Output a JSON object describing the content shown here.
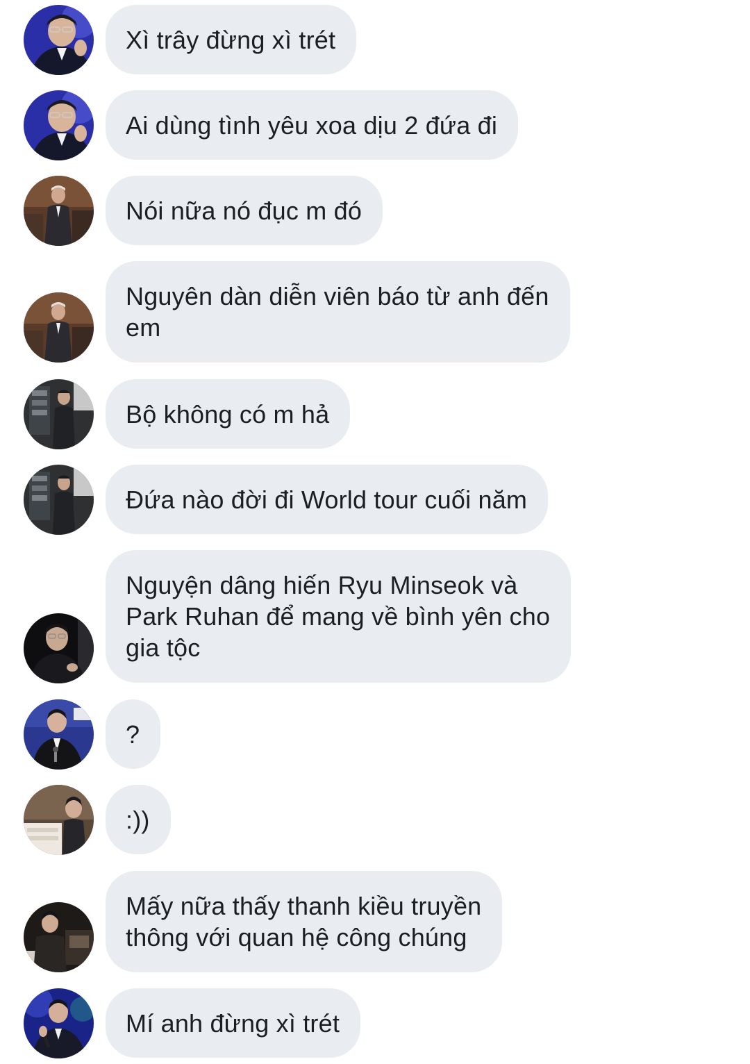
{
  "messages": [
    {
      "text": "Xì trây đừng xì trét",
      "avatar": "avatar-blue-stage"
    },
    {
      "text": "Ai dùng tình yêu xoa dịu 2 đứa đi",
      "avatar": "avatar-blue-stage"
    },
    {
      "text": "Nói nữa nó đục m đó",
      "avatar": "avatar-suit-warm"
    },
    {
      "text": "Nguyên dàn diễn viên báo từ anh đến\nem",
      "avatar": "avatar-suit-warm"
    },
    {
      "text": "Bộ không có m hả",
      "avatar": "avatar-suit-dark"
    },
    {
      "text": "Đứa nào đời đi World tour cuối năm",
      "avatar": "avatar-suit-dark"
    },
    {
      "text": "Nguyện dâng hiến Ryu Minseok và\nPark Ruhan để mang về bình yên cho\ngia tộc",
      "avatar": "avatar-dark-portrait"
    },
    {
      "text": "?",
      "avatar": "avatar-event-suit"
    },
    {
      "text": ":))",
      "avatar": "avatar-piano"
    },
    {
      "text": "Mấy nữa thấy thanh kiều truyền\nthông với quan hệ công chúng",
      "avatar": "avatar-dark-room"
    },
    {
      "text": "Mí anh đừng xì trét",
      "avatar": "avatar-blue-concert"
    }
  ]
}
